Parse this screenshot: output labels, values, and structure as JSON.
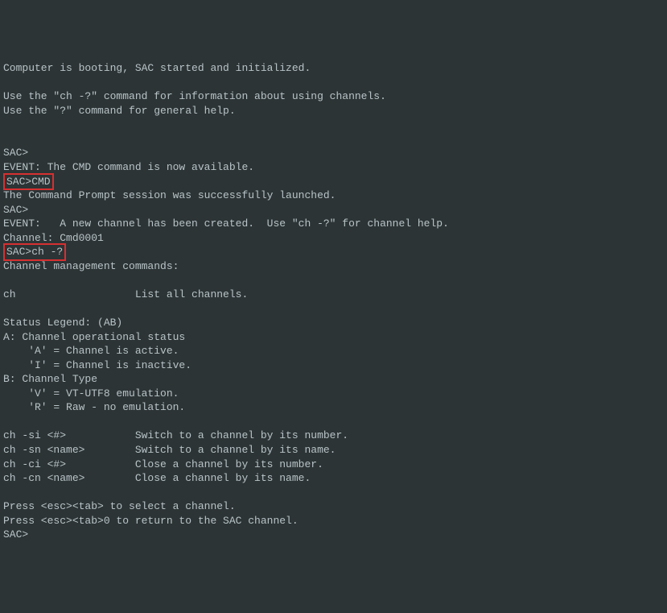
{
  "terminal": {
    "lines": [
      {
        "text": "Computer is booting, SAC started and initialized."
      },
      {
        "text": ""
      },
      {
        "text": "Use the \"ch -?\" command for information about using channels."
      },
      {
        "text": "Use the \"?\" command for general help."
      },
      {
        "text": ""
      },
      {
        "text": ""
      },
      {
        "text": "SAC>"
      },
      {
        "text": "EVENT: The CMD command is now available."
      },
      {
        "text": "SAC>CMD",
        "highlight": true
      },
      {
        "text": "The Command Prompt session was successfully launched."
      },
      {
        "text": "SAC>"
      },
      {
        "text": "EVENT:   A new channel has been created.  Use \"ch -?\" for channel help."
      },
      {
        "text": "Channel: Cmd0001"
      },
      {
        "text": "SAC>ch -?",
        "highlight": true
      },
      {
        "text": "Channel management commands:"
      },
      {
        "text": ""
      },
      {
        "text": "ch                   List all channels."
      },
      {
        "text": ""
      },
      {
        "text": "Status Legend: (AB)"
      },
      {
        "text": "A: Channel operational status"
      },
      {
        "text": "    'A' = Channel is active."
      },
      {
        "text": "    'I' = Channel is inactive."
      },
      {
        "text": "B: Channel Type"
      },
      {
        "text": "    'V' = VT-UTF8 emulation."
      },
      {
        "text": "    'R' = Raw - no emulation."
      },
      {
        "text": ""
      },
      {
        "text": "ch -si <#>           Switch to a channel by its number."
      },
      {
        "text": "ch -sn <name>        Switch to a channel by its name."
      },
      {
        "text": "ch -ci <#>           Close a channel by its number."
      },
      {
        "text": "ch -cn <name>        Close a channel by its name."
      },
      {
        "text": ""
      },
      {
        "text": "Press <esc><tab> to select a channel."
      },
      {
        "text": "Press <esc><tab>0 to return to the SAC channel."
      },
      {
        "text": "SAC>"
      }
    ]
  }
}
